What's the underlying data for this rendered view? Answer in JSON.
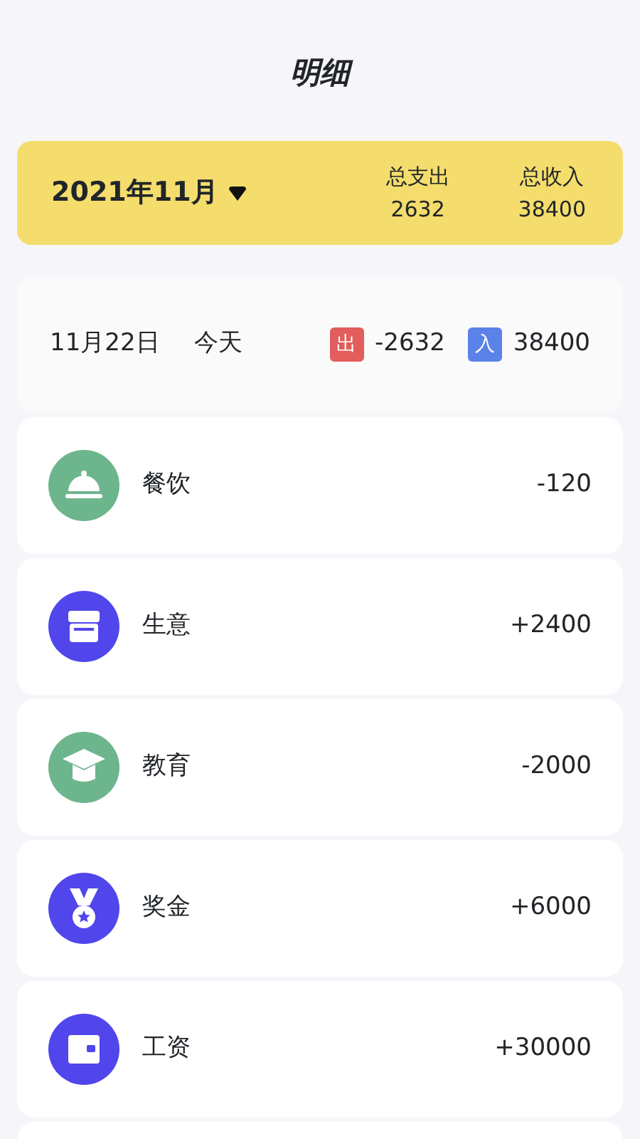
{
  "title": "明细",
  "summary": {
    "month": "2021年11月",
    "expense_label": "总支出",
    "expense": "2632",
    "income_label": "总收入",
    "income": "38400"
  },
  "day": {
    "date": "11月22日",
    "day_label": "今天",
    "out_tag": "出",
    "out_amount": "-2632",
    "in_tag": "入",
    "in_amount": "38400"
  },
  "records": [
    {
      "name": "餐饮",
      "amount": "-120",
      "kind": "dining",
      "color": "#6db58d"
    },
    {
      "name": "生意",
      "amount": "+2400",
      "kind": "business",
      "color": "#5046ec"
    },
    {
      "name": "教育",
      "amount": "-2000",
      "kind": "education",
      "color": "#6db58d"
    },
    {
      "name": "奖金",
      "amount": "+6000",
      "kind": "bonus",
      "color": "#5046ec"
    },
    {
      "name": "工资",
      "amount": "+30000",
      "kind": "salary",
      "color": "#5046ec"
    }
  ]
}
